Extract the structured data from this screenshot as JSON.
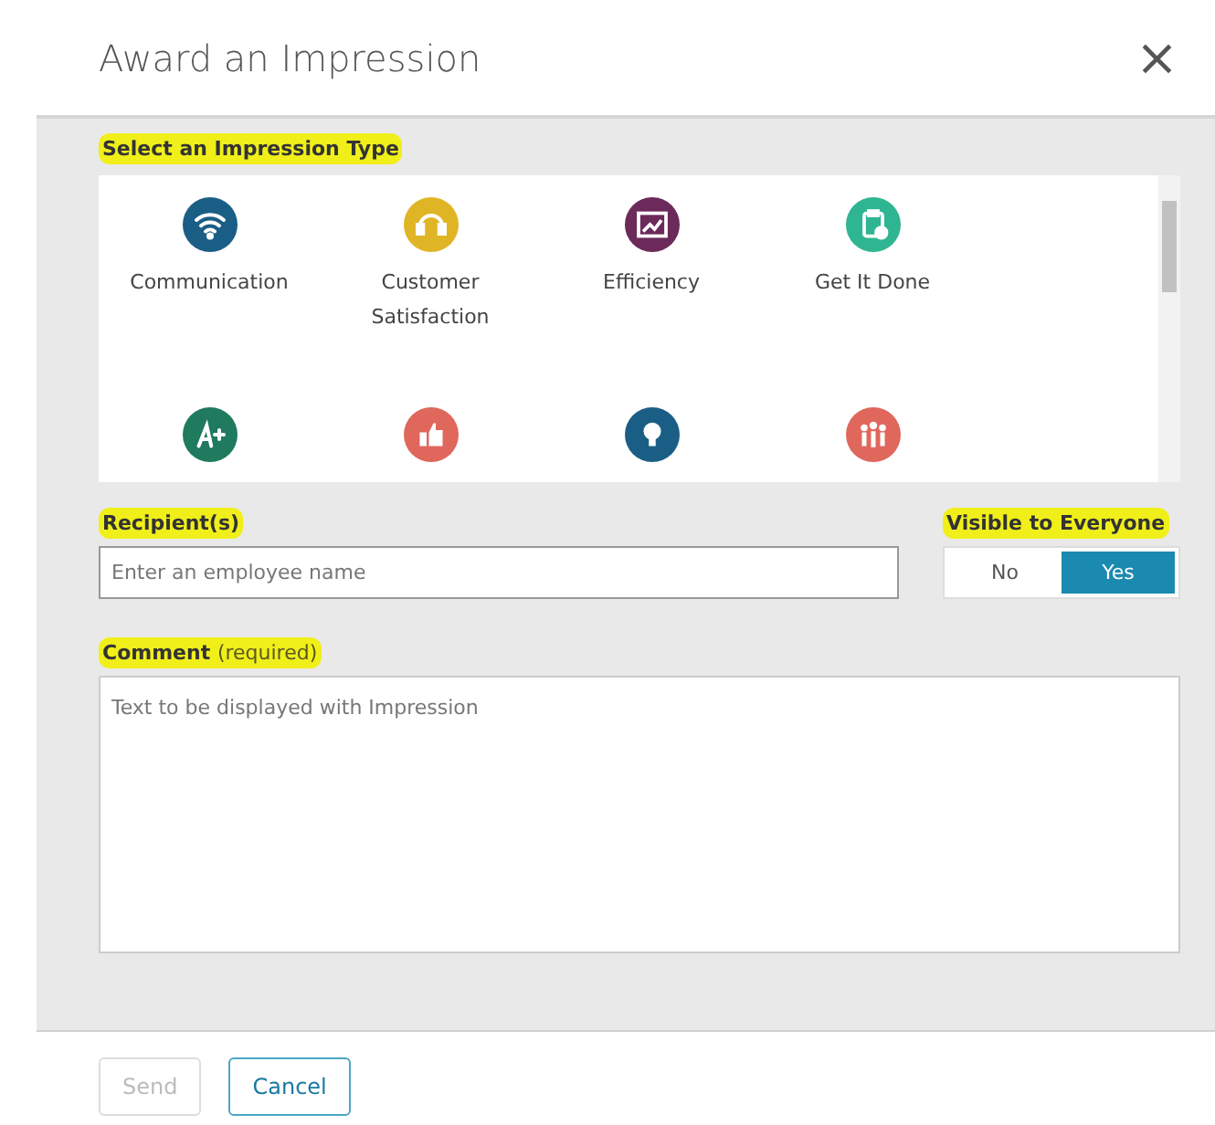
{
  "dialog": {
    "title": "Award an Impression",
    "close_glyph": "×"
  },
  "impression_type": {
    "label": "Select an Impression Type",
    "highlighted": true,
    "items": [
      {
        "kind": "wifi",
        "color": "#1b5e85",
        "label_lines": [
          "Communication"
        ]
      },
      {
        "kind": "headset",
        "color": "#e0b525",
        "label_lines": [
          "Customer",
          "Satisfaction"
        ]
      },
      {
        "kind": "chart",
        "color": "#6b2a5a",
        "label_lines": [
          "Efficiency"
        ]
      },
      {
        "kind": "clipboard",
        "color": "#2fb592",
        "label_lines": [
          "Get It Done"
        ]
      },
      {
        "kind": "grade",
        "color": "#1f7a5e"
      },
      {
        "kind": "thumb",
        "color": "#e0675c"
      },
      {
        "kind": "bulb",
        "color": "#1b5e85"
      },
      {
        "kind": "people",
        "color": "#e0675c"
      }
    ]
  },
  "recipients": {
    "label": "Recipient(s)",
    "highlighted": true,
    "placeholder": "Enter an employee name"
  },
  "visibility": {
    "label": "Visible to Everyone",
    "highlighted": true,
    "options": [
      {
        "label": "No",
        "selected": false
      },
      {
        "label": "Yes",
        "selected": true
      }
    ]
  },
  "comment": {
    "label": "Comment",
    "note": "(required)",
    "highlighted": true,
    "placeholder": "Text to be displayed with Impression"
  },
  "buttons": [
    {
      "label": "Send",
      "kind": "primary",
      "disabled": true
    },
    {
      "label": "Cancel",
      "kind": "secondary",
      "disabled": false
    }
  ]
}
